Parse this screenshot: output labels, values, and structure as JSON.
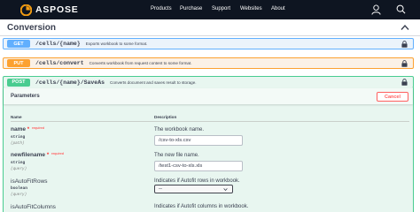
{
  "header": {
    "logo_text": "ASPOSE",
    "nav": [
      "Products",
      "Purchase",
      "Support",
      "Websites",
      "About"
    ],
    "icons": [
      "user-icon",
      "search-icon"
    ],
    "colors": {
      "background": "#0e1521",
      "logo_accent": "#f39c12"
    }
  },
  "section": {
    "title": "Conversion",
    "chevron": "chevron-up-icon"
  },
  "operations": [
    {
      "method": "GET",
      "path": "/cells/{name}",
      "summary": "Exports workbook to some format.",
      "color": "#61affe"
    },
    {
      "method": "PUT",
      "path": "/cells/convert",
      "summary": "Converts workbook from request content to some format.",
      "color": "#fca130"
    },
    {
      "method": "POST",
      "path": "/cells/{name}/SaveAs",
      "summary": "Converts document and saves result to storage.",
      "color": "#49cc90"
    }
  ],
  "post_panel": {
    "parameters_label": "Parameters",
    "cancel_label": "Cancel",
    "column_name": "Name",
    "column_description": "Description",
    "params": [
      {
        "name": "name",
        "required_star": "*",
        "required_text": "required",
        "type": "string",
        "in": "(path)",
        "description": "The workbook name.",
        "value": "/csv-to-xls.csv"
      },
      {
        "name": "newfilename",
        "required_star": "*",
        "required_text": "required",
        "type": "string",
        "in": "(query)",
        "description": "The new file name.",
        "value": "/test1-csv-to-xls.xls"
      },
      {
        "name": "isAutoFitRows",
        "type": "boolean",
        "in": "(query)",
        "description": "Indicates if Autofit rows in workbook.",
        "selected": "--"
      },
      {
        "name": "isAutoFitColumns",
        "description": "Indicates if Autofit columns in workbook."
      }
    ]
  }
}
